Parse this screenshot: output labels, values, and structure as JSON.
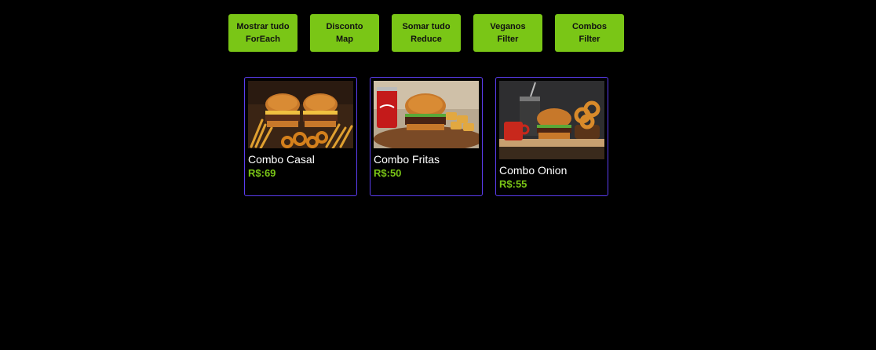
{
  "buttons": [
    {
      "line1": "Mostrar tudo",
      "line2": "ForEach"
    },
    {
      "line1": "Disconto",
      "line2": "Map"
    },
    {
      "line1": "Somar tudo",
      "line2": "Reduce"
    },
    {
      "line1": "Veganos",
      "line2": "Filter"
    },
    {
      "line1": "Combos",
      "line2": "Filter"
    }
  ],
  "products": [
    {
      "name": "Combo Casal",
      "price": "R$:69",
      "image": "double-burger-fries-image"
    },
    {
      "name": "Combo Fritas",
      "price": "R$:50",
      "image": "burger-coke-fries-image"
    },
    {
      "name": "Combo Onion",
      "price": "R$:55",
      "image": "burger-onion-rings-image"
    }
  ],
  "colors": {
    "background": "#000000",
    "accent": "#7ac616",
    "card_border": "#5b3df0",
    "text": "#ffffff"
  }
}
